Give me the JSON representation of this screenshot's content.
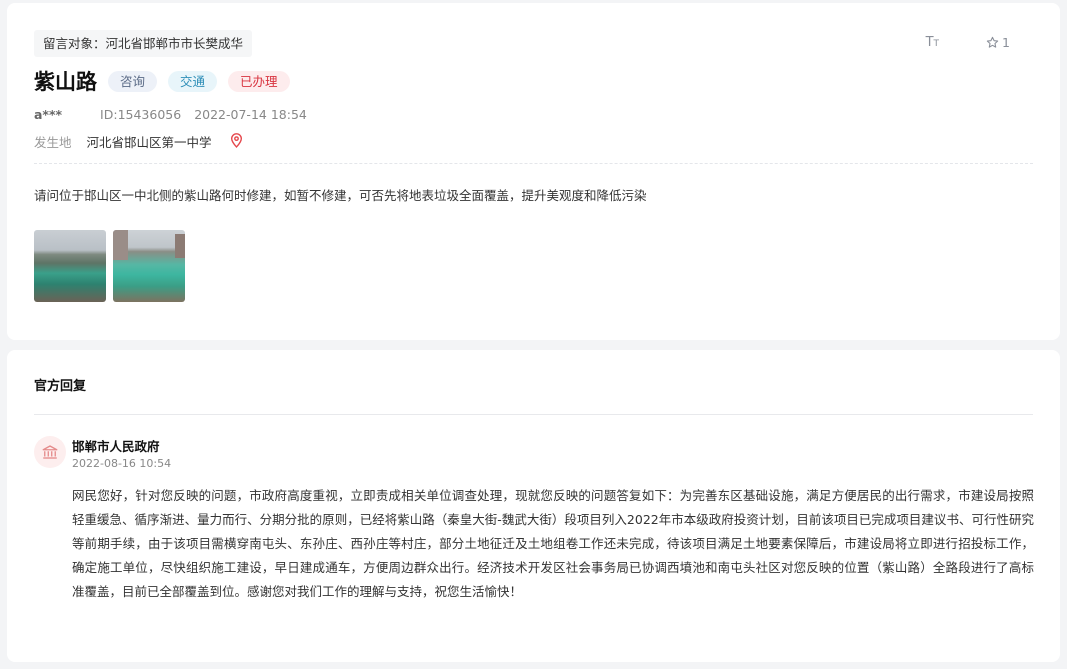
{
  "message": {
    "target": "留言对象：河北省邯郸市市长樊成华",
    "title": "紫山路",
    "tags": [
      "咨询",
      "交通",
      "已办理"
    ],
    "author": "a***",
    "id_text": "ID:15436056",
    "datetime": "2022-07-14 18:54",
    "place_label": "发生地",
    "place_value": "河北省邯山区第一中学",
    "content": "请问位于邯山区一中北侧的紫山路何时修建，如暂不修建，可否先将地表垃圾全面覆盖，提升美观度和降低污染",
    "favorite_count": "1",
    "font_icon": "font-size-icon",
    "favorite_icon": "star-icon",
    "location_icon": "location-pin-icon",
    "images": [
      "photo-1",
      "photo-2"
    ]
  },
  "reply": {
    "section_title": "官方回复",
    "org_name": "邯郸市人民政府",
    "org_icon": "government-building-icon",
    "datetime": "2022-08-16 10:54",
    "text": "网民您好，针对您反映的问题，市政府高度重视，立即责成相关单位调查处理，现就您反映的问题答复如下：为完善东区基础设施，满足方便居民的出行需求，市建设局按照轻重缓急、循序渐进、量力而行、分期分批的原则，已经将紫山路（秦皇大街-魏武大街）段项目列入2022年市本级政府投资计划，目前该项目已完成项目建议书、可行性研究等前期手续，由于该项目需横穿南屯头、东孙庄、西孙庄等村庄，部分土地征迁及土地组卷工作还未完成，待该项目满足土地要素保障后，市建设局将立即进行招投标工作，确定施工单位，尽快组织施工建设，早日建成通车，方便周边群众出行。经济技术开发区社会事务局已协调西墳池和南屯头社区对您反映的位置（紫山路）全路段进行了高标准覆盖，目前已全部覆盖到位。感谢您对我们工作的理解与支持，祝您生活愉快！"
  },
  "colors": {
    "page_bg": "#f3f4f6",
    "card_bg": "#ffffff",
    "tag_done": "#d8333f",
    "tag_traffic": "#2f8fb8",
    "tag_consult": "#5a6a86",
    "location_pin": "#e5484d"
  }
}
